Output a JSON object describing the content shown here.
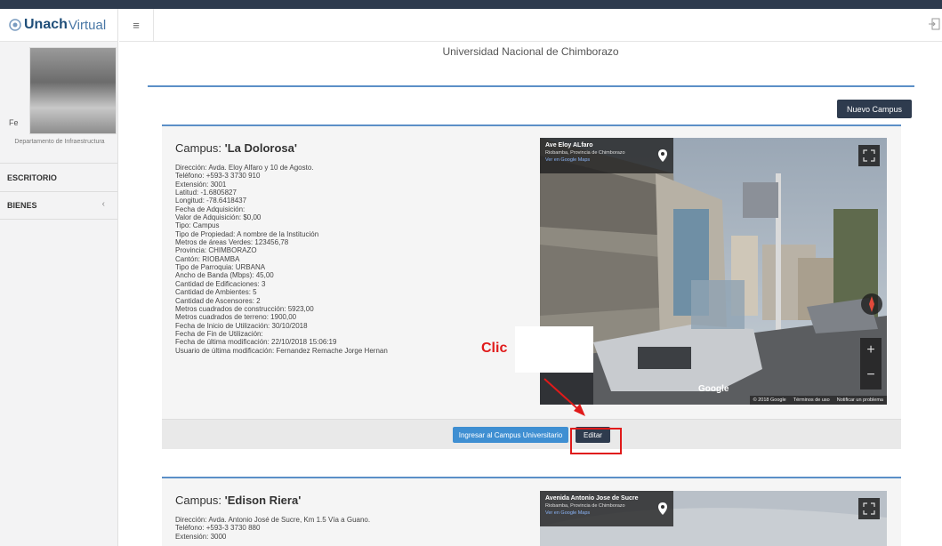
{
  "brand": {
    "strong": "Unach",
    "light": "Virtual"
  },
  "sidebar": {
    "profile_initial": "Fe",
    "department": "Departamento de Infraestructura",
    "items": [
      {
        "label": "ESCRITORIO"
      },
      {
        "label": "BIENES",
        "caret": "‹"
      }
    ]
  },
  "header": {
    "menu_icon": "≡"
  },
  "page": {
    "title": "Universidad Nacional de Chimborazo"
  },
  "toolbar": {
    "new_campus_label": "Nuevo Campus"
  },
  "campuses": [
    {
      "title_prefix": "Campus: ",
      "title_name": "'La Dolorosa'",
      "details": [
        "Dirección: Avda. Eloy Alfaro y 10 de Agosto.",
        "Teléfono: +593-3 3730 910",
        "Extensión: 3001",
        "Latitud: -1.6805827",
        "Longitud: -78.6418437",
        "Fecha de Adquisición:",
        "Valor de Adquisición: $0,00",
        "Tipo: Campus",
        "Tipo de Propiedad: A nombre de la Institución",
        "Metros de áreas Verdes: 123456,78",
        "Provincia: CHIMBORAZO",
        "Cantón: RIOBAMBA",
        "Tipo de Parroquia: URBANA",
        "Ancho de Banda (Mbps): 45,00",
        "Cantidad de Edificaciones: 3",
        "Cantidad de Ambientes: 5",
        "Cantidad de Ascensores: 2",
        "Metros cuadrados de construcción: 5923,00",
        "Metros cuadrados de terreno: 1900,00",
        "Fecha de Inicio de Utilización: 30/10/2018",
        "Fecha de Fin de Utilización:",
        "Fecha de última modificación: 22/10/2018 15:06:19",
        "Usuario de última modificación: Fernandez Remache Jorge Hernan"
      ],
      "map": {
        "street": "Ave Eloy ALfaro",
        "city": "Riobamba, Provincia de Chimborazo",
        "link": "Ver en Google Maps",
        "google": "Google",
        "copyright": "© 2018 Google",
        "terms": "Términos de uso",
        "report": "Notificar un problema"
      },
      "buttons": {
        "enter": "Ingresar al Campus Universitario",
        "edit": "Editar"
      }
    },
    {
      "title_prefix": "Campus: ",
      "title_name": "'Edison Riera'",
      "details": [
        "Dirección: Avda. Antonio José de Sucre, Km 1.5 Vía a Guano.",
        "Teléfono: +593-3 3730 880",
        "Extensión: 3000"
      ],
      "map": {
        "street": "Avenida Antonio Jose de Sucre",
        "city": "Riobamba, Provincia de Chimborazo",
        "link": "Ver en Google Maps"
      }
    }
  ],
  "annotation": {
    "text": "Clic",
    "color": "#e01a1a"
  },
  "colors": {
    "primary_dark": "#2e3b4e",
    "accent_blue": "#3f8fd2",
    "panel_border": "#5b8fc7"
  }
}
